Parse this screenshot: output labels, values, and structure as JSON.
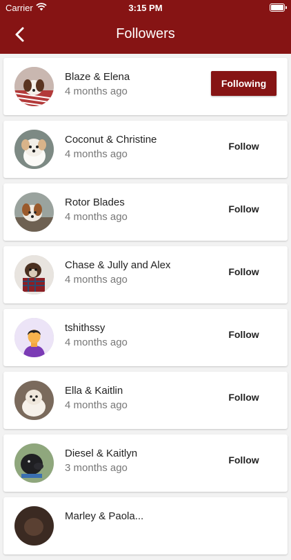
{
  "status_bar": {
    "carrier": "Carrier",
    "time": "3:15 PM"
  },
  "header": {
    "title": "Followers",
    "back_icon": "chevron-left-icon"
  },
  "colors": {
    "brand": "#861414",
    "background": "#f2f2f2"
  },
  "followers": [
    {
      "name": "Blaze & Elena",
      "time": "4 months ago",
      "button": "Following",
      "following": true,
      "avatar": "dog-photo-avatar"
    },
    {
      "name": "Coconut & Christine",
      "time": "4 months ago",
      "button": "Follow",
      "following": false,
      "avatar": "dog-photo-avatar"
    },
    {
      "name": "Rotor Blades",
      "time": "4 months ago",
      "button": "Follow",
      "following": false,
      "avatar": "dog-photo-avatar"
    },
    {
      "name": "Chase & Jully and Alex",
      "time": "4 months ago",
      "button": "Follow",
      "following": false,
      "avatar": "dog-photo-avatar"
    },
    {
      "name": "tshithssy",
      "time": "4 months ago",
      "button": "Follow",
      "following": false,
      "avatar": "default-person-avatar"
    },
    {
      "name": "Ella & Kaitlin",
      "time": "4 months ago",
      "button": "Follow",
      "following": false,
      "avatar": "dog-photo-avatar"
    },
    {
      "name": "Diesel & Kaitlyn",
      "time": "3 months ago",
      "button": "Follow",
      "following": false,
      "avatar": "dog-photo-avatar"
    },
    {
      "name": "Marley & Paola...",
      "time": "",
      "button": "",
      "following": false,
      "avatar": "dog-photo-avatar"
    }
  ]
}
